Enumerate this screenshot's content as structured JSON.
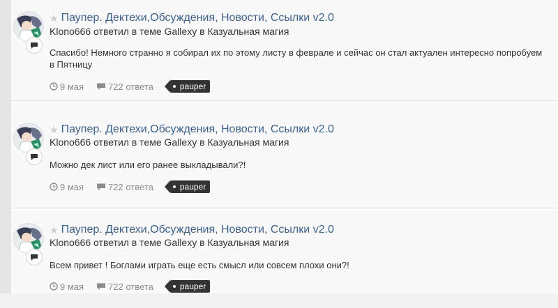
{
  "activity": [
    {
      "title": "Паупер. Дектехи,Обсуждения, Новости, Ссылки v2.0",
      "meta": "Klono666 ответил в теме Gallexy в Казуальная магия",
      "snippet": "Спасибо! Немного странно я собирал их по этому листу в феврале и сейчас он стал актуален интересно попробуем в Пятницу",
      "date": "9 мая",
      "replies": "722 ответа",
      "tag": "pauper"
    },
    {
      "title": "Паупер. Дектехи,Обсуждения, Новости, Ссылки v2.0",
      "meta": "Klono666 ответил в теме Gallexy в Казуальная магия",
      "snippet": "Можно дек лист или его ранее выкладывали?!",
      "date": "9 мая",
      "replies": "722 ответа",
      "tag": "pauper"
    },
    {
      "title": "Паупер. Дектехи,Обсуждения, Новости, Ссылки v2.0",
      "meta": "Klono666 ответил в теме Gallexy в Казуальная магия",
      "snippet": "Всем привет ! Боглами играть еще есть смысл или совсем плохи они?!",
      "date": "9 мая",
      "replies": "722 ответа",
      "tag": "pauper"
    }
  ],
  "colors": {
    "title_link": "#3e628d",
    "tag_bg": "#333333",
    "muted": "#8c8c8c"
  },
  "icons": {
    "star": "star-icon",
    "clock": "clock-icon",
    "comment": "comment-icon",
    "badge": "speech-bubble-icon"
  }
}
